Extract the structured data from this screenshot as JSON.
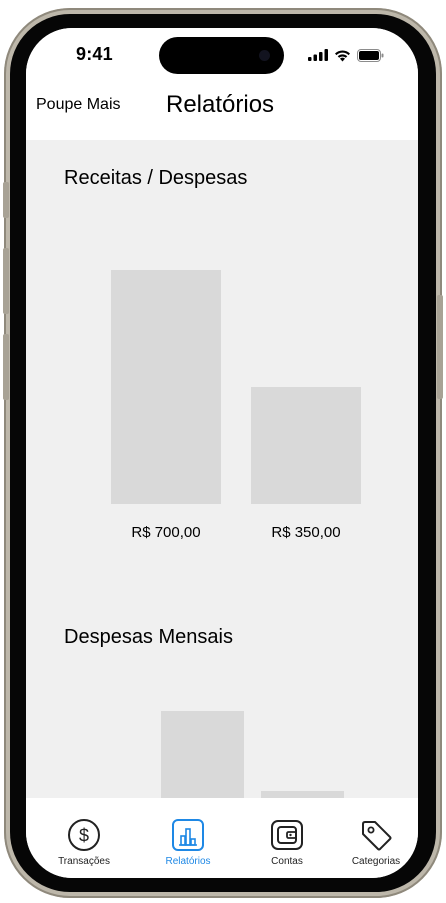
{
  "status_bar": {
    "time": "9:41"
  },
  "header": {
    "app_name": "Poupe Mais",
    "title": "Relatórios"
  },
  "sections": [
    {
      "title": "Receitas / Despesas"
    },
    {
      "title": "Despesas Mensais"
    }
  ],
  "chart_data": [
    {
      "type": "bar",
      "title": "Receitas / Despesas",
      "categories": [
        "R$ 700,00",
        "R$ 350,00"
      ],
      "values": [
        700,
        350
      ],
      "xlabel": "",
      "ylabel": "",
      "ylim": [
        0,
        700
      ],
      "grid": false
    },
    {
      "type": "bar",
      "title": "Despesas Mensais",
      "categories": [
        "",
        ""
      ],
      "values": [
        100,
        36
      ],
      "xlabel": "",
      "ylabel": "",
      "ylim": [
        0,
        100
      ],
      "grid": false
    }
  ],
  "colors": {
    "accent": "#1e88e5",
    "bar": "#d9d9d9",
    "screen_bg": "#f0f0f0"
  },
  "tabs": [
    {
      "label": "Transações",
      "icon": "dollar-circle-icon",
      "active": false
    },
    {
      "label": "Relatórios",
      "icon": "bar-chart-icon",
      "active": true
    },
    {
      "label": "Contas",
      "icon": "wallet-icon",
      "active": false
    },
    {
      "label": "Categorias",
      "icon": "tag-icon",
      "active": false
    }
  ]
}
